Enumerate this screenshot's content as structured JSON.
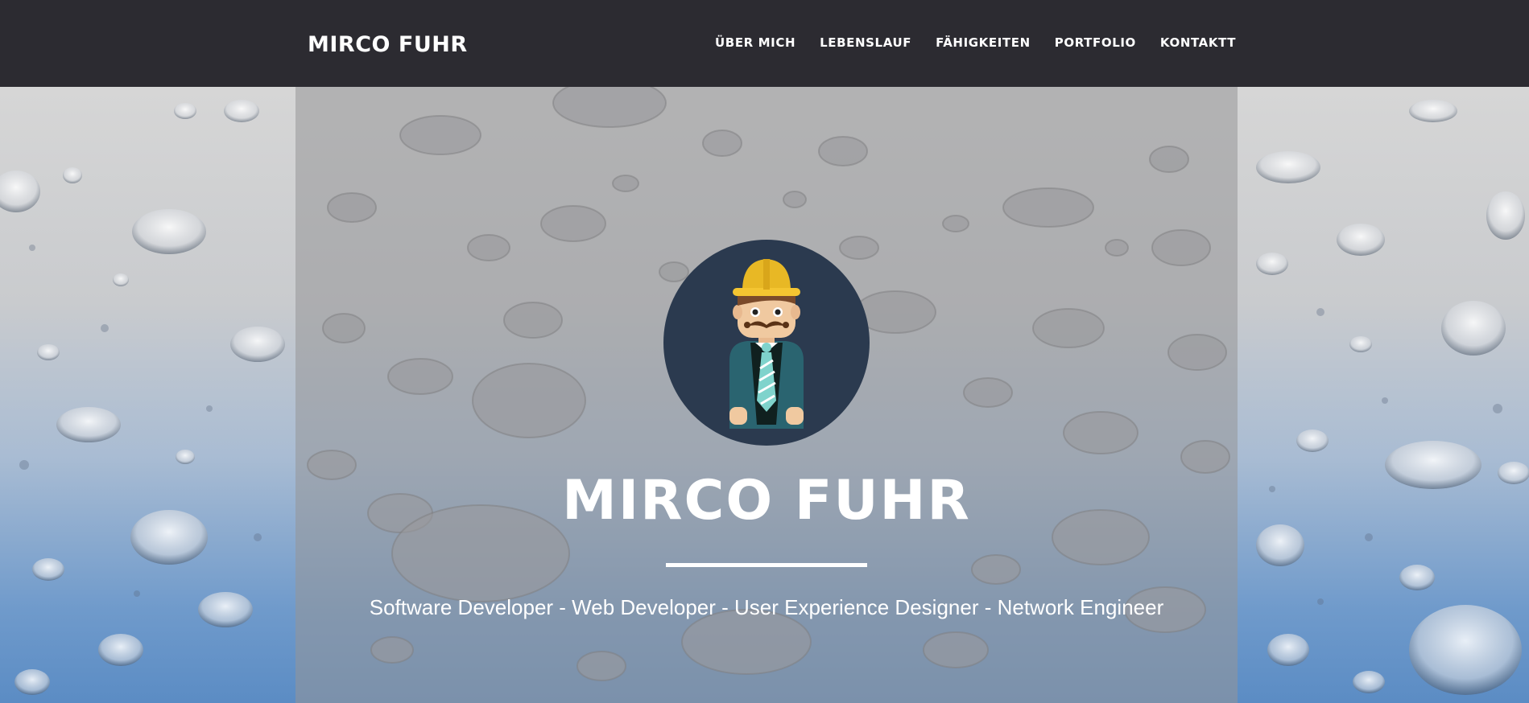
{
  "navbar": {
    "brand": "MIRCO FUHR",
    "links": [
      {
        "label": "ÜBER MICH"
      },
      {
        "label": "LEBENSLAUF"
      },
      {
        "label": "FÄHIGKEITEN"
      },
      {
        "label": "PORTFOLIO"
      },
      {
        "label": "KONTAKTT"
      }
    ]
  },
  "hero": {
    "title": "MIRCO FUHR",
    "subtitle": "Software Developer - Web Developer - User Experience Designer - Network Engineer",
    "avatar": {
      "icon": "engineer-avatar-icon"
    }
  },
  "colors": {
    "navbar_bg": "#2c2b31",
    "avatar_circle": "#2b3a4f",
    "helmet": "#e8b825",
    "jacket": "#2a6470",
    "tie": "#7fd3cc"
  }
}
